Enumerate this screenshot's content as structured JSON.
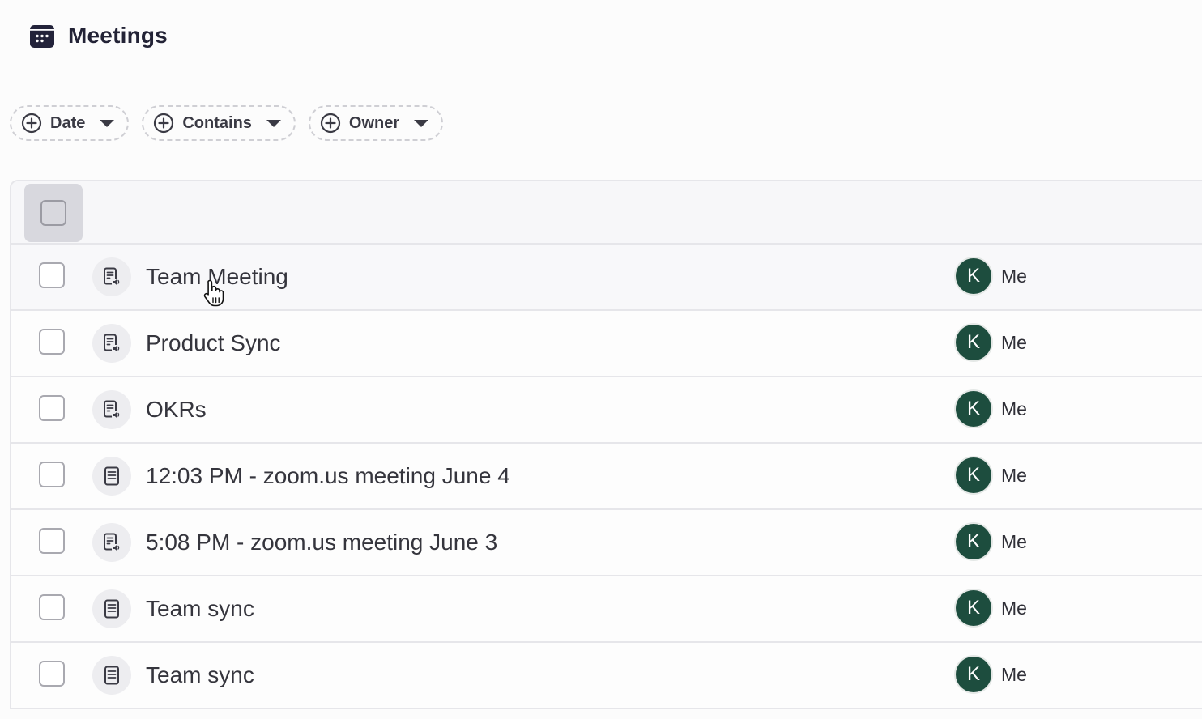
{
  "header": {
    "title": "Meetings",
    "icon": "calendar-icon"
  },
  "filters": [
    {
      "label": "Date",
      "icon": "plus-circle-icon"
    },
    {
      "label": "Contains",
      "icon": "plus-circle-icon"
    },
    {
      "label": "Owner",
      "icon": "plus-circle-icon"
    }
  ],
  "rows": [
    {
      "name": "Team Meeting",
      "icon": "audio-transcript-icon",
      "owner_initial": "K",
      "owner": "Me"
    },
    {
      "name": "Product Sync",
      "icon": "audio-transcript-icon",
      "owner_initial": "K",
      "owner": "Me"
    },
    {
      "name": "OKRs",
      "icon": "audio-transcript-icon",
      "owner_initial": "K",
      "owner": "Me"
    },
    {
      "name": "12:03 PM - zoom.us meeting June 4",
      "icon": "document-icon",
      "owner_initial": "K",
      "owner": "Me"
    },
    {
      "name": "5:08 PM - zoom.us meeting June 3",
      "icon": "audio-transcript-icon",
      "owner_initial": "K",
      "owner": "Me"
    },
    {
      "name": "Team sync",
      "icon": "document-icon",
      "owner_initial": "K",
      "owner": "Me"
    },
    {
      "name": "Team sync",
      "icon": "document-icon",
      "owner_initial": "K",
      "owner": "Me"
    }
  ],
  "colors": {
    "avatar_bg": "#1d4d3e",
    "header_bg": "#f7f7f9",
    "border": "#e6e6ea"
  }
}
